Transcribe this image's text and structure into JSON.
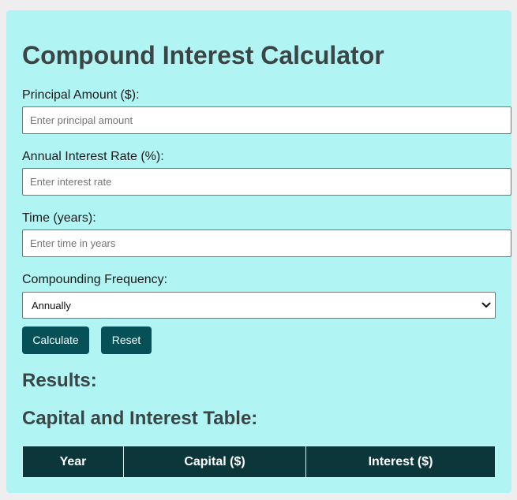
{
  "app": {
    "title": "Compound Interest Calculator"
  },
  "form": {
    "principal": {
      "label": "Principal Amount ($):",
      "placeholder": "Enter principal amount",
      "value": ""
    },
    "rate": {
      "label": "Annual Interest Rate (%):",
      "placeholder": "Enter interest rate",
      "value": ""
    },
    "time": {
      "label": "Time (years):",
      "placeholder": "Enter time in years",
      "value": ""
    },
    "frequency": {
      "label": "Compounding Frequency:",
      "selected": "Annually"
    }
  },
  "buttons": {
    "calculate": "Calculate",
    "reset": "Reset"
  },
  "results": {
    "heading": "Results:"
  },
  "table": {
    "heading": "Capital and Interest Table:",
    "columns": [
      "Year",
      "Capital ($)",
      "Interest ($)"
    ]
  },
  "colors": {
    "card_background": "#b0f4f4",
    "button": "#065157",
    "table_header": "#0b373a",
    "heading_text": "#3c4545"
  },
  "icons": {
    "select_arrow": "chevron-down-icon"
  }
}
